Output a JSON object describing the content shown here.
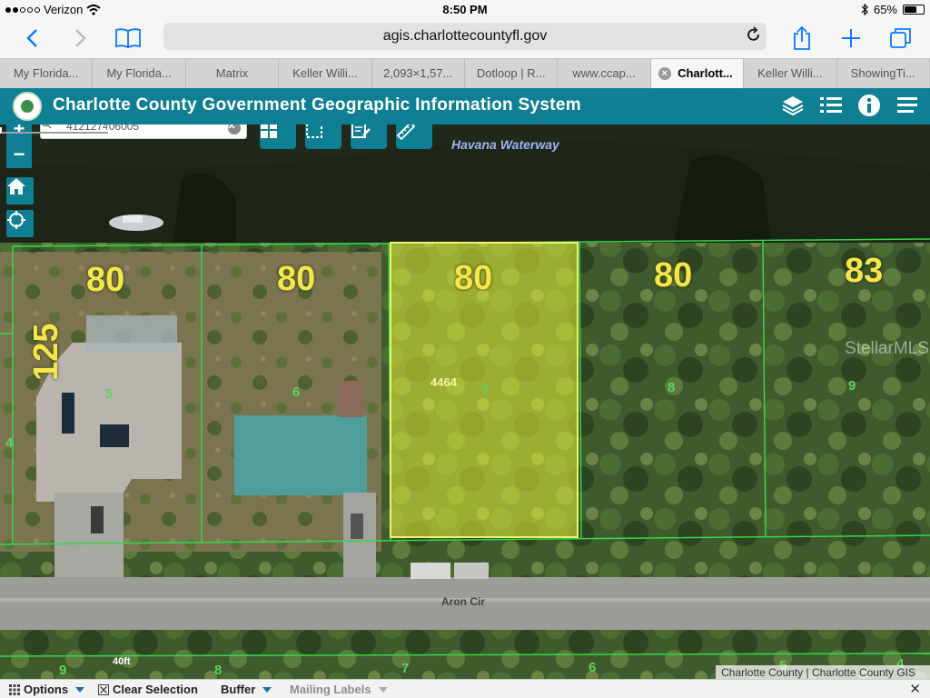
{
  "status_bar": {
    "carrier": "Verizon",
    "time": "8:50 PM",
    "battery": "65%",
    "battery_level": 0.65,
    "icons": [
      "wifi-icon",
      "bluetooth-icon",
      "battery-icon"
    ]
  },
  "browser": {
    "url": "agis.charlottecountyfl.gov",
    "tabs": [
      {
        "label": "My Florida..."
      },
      {
        "label": "My Florida..."
      },
      {
        "label": "Matrix"
      },
      {
        "label": "Keller Willi..."
      },
      {
        "label": "2,093×1,57..."
      },
      {
        "label": "Dotloop | R..."
      },
      {
        "label": "www.ccap..."
      },
      {
        "label": "Charlott...",
        "active": true
      },
      {
        "label": "Keller Willi..."
      },
      {
        "label": "ShowingTi..."
      }
    ],
    "tab_close_glyph": "×"
  },
  "gis": {
    "title": "Charlotte County Government Geographic Information System",
    "search_value": "412127406005",
    "tools": [
      "layers-icon",
      "legend-list-icon",
      "info-icon",
      "menu-icon"
    ],
    "map_tools": [
      "basemap-grid-icon",
      "select-box-icon",
      "identify-icon",
      "measure-ruler-icon"
    ],
    "zoom_in": "+",
    "zoom_out": "−"
  },
  "map": {
    "waterway": "Havana Waterway",
    "street": "Aron Cir",
    "lot_frontages": [
      "80",
      "80",
      "80",
      "80",
      "83",
      "125"
    ],
    "parcel_numbers": [
      "5",
      "6",
      "7",
      "8",
      "9",
      "4"
    ],
    "south_parcel_numbers": [
      "9",
      "8",
      "7",
      "6",
      "5",
      "4"
    ],
    "address": "4464",
    "watermark": "StellarMLS",
    "scale_label": "40ft",
    "attribution": "Charlotte County | Charlotte County GIS"
  },
  "bottom_bar": {
    "options": "Options",
    "clear_selection": "Clear Selection",
    "buffer": "Buffer",
    "mailing_labels": "Mailing Labels",
    "close": "✕"
  },
  "colors": {
    "header": "#0f7f93",
    "selected_parcel": "#e8f23a",
    "parcel_lines": "#33d94a",
    "lot_label": "#f5e74a",
    "ios_blue": "#0a7aff"
  }
}
